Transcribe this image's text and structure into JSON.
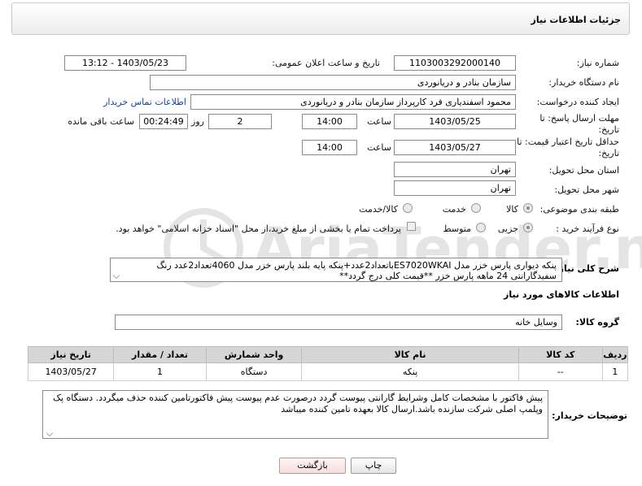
{
  "panel": {
    "title": "جزئیات اطلاعات نیاز"
  },
  "fields": {
    "need_number": {
      "label": "شماره نیاز:",
      "value": "1103003292000140"
    },
    "announce_datetime": {
      "label": "تاریخ و ساعت اعلان عمومی:",
      "value": "1403/05/23 - 13:12"
    },
    "buyer_org": {
      "label": "نام دستگاه خریدار:",
      "value": "سازمان بنادر و دریانوردی"
    },
    "requester": {
      "label": "ایجاد کننده درخواست:",
      "value": "محمود اسفندیاری فرد کارپرداز سازمان بنادر و دریانوردی",
      "contact_link": "اطلاعات تماس خریدار"
    },
    "reply_deadline": {
      "label_line1": "مهلت ارسال پاسخ: تا",
      "label_line2": "تاریخ:",
      "date": "1403/05/25",
      "time_label": "ساعت",
      "time": "14:00",
      "days": "2",
      "days_label": "روز و",
      "remaining": "00:24:49",
      "remaining_label": "ساعت باقی مانده"
    },
    "price_validity": {
      "label_line1": "حداقل تاریخ اعتبار قیمت: تا",
      "label_line2": "تاریخ:",
      "date": "1403/05/27",
      "time_label": "ساعت",
      "time": "14:00"
    },
    "delivery_province": {
      "label": "استان محل تحویل:",
      "value": "تهران"
    },
    "delivery_city": {
      "label": "شهر محل تحویل:",
      "value": "تهران"
    },
    "category": {
      "label": "طبقه بندی موضوعی:",
      "options": [
        "کالا",
        "خدمت",
        "کالا/خدمت"
      ],
      "selected": "کالا"
    },
    "purchase_type": {
      "label": "نوع فرآیند خرید :",
      "options": [
        "جزیی",
        "متوسط"
      ],
      "selected": "جزیی",
      "payment_note": "پرداخت تمام یا بخشی از مبلغ خرید،از محل \"اسناد خزانه اسلامی\" خواهد بود."
    }
  },
  "general_description": {
    "label": "شرح کلی نیاز:",
    "text": "پنکه دیواری پارس خزر مدل ES7020WKAIباتعداد2عدد+پنکه پایه بلند پارس خزر مدل 4060تعداد2عدد رنگ سفیدگارانتی 24 ماهه پارس خزر **قیمت کلی درج گردد**"
  },
  "goods_info": {
    "title": "اطلاعات کالاهای مورد نیاز",
    "group_label": "گروه کالا:",
    "group_value": "وسایل خانه"
  },
  "table": {
    "headers": [
      "ردیف",
      "کد کالا",
      "نام کالا",
      "واحد شمارش",
      "تعداد / مقدار",
      "تاریخ نیاز"
    ],
    "rows": [
      [
        "1",
        "--",
        "پنکه",
        "دستگاه",
        "1",
        "1403/05/27"
      ]
    ]
  },
  "buyer_notes": {
    "label": "توضیحات خریدار:",
    "text": "پیش فاکتور با مشخصات کامل وشرایط گارانتی پیوست گردد درصورت عدم پیوست پیش فاکتورتامین کننده حذف میگردد. دستگاه پک وپلمپ اصلی شرکت سازنده باشد.ارسال کالا بعهده تامین کننده میباشد"
  },
  "buttons": {
    "print": "چاپ",
    "back": "بازگشت"
  },
  "watermark": {
    "text": "AriaTender.neT"
  }
}
